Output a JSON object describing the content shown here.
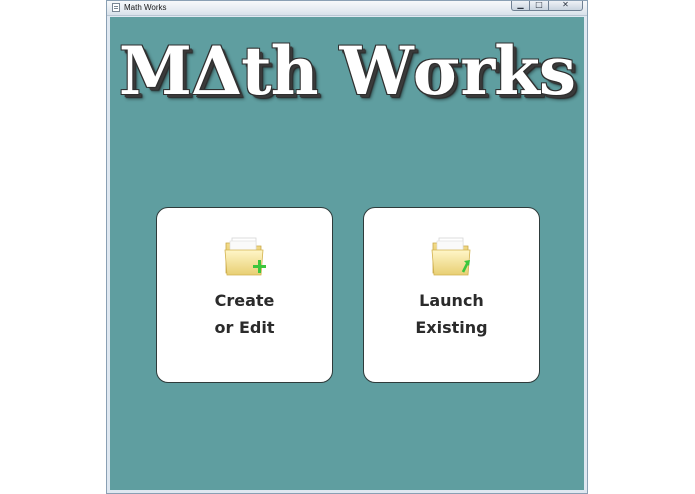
{
  "window": {
    "title": "Math Works",
    "controls": {
      "minimize_icon": "minimize-icon",
      "maximize_icon": "maximize-icon",
      "close_icon": "close-icon"
    }
  },
  "app": {
    "heading": "MΔth Wσrks",
    "background_color": "#5f9ea0"
  },
  "tiles": [
    {
      "id": "create",
      "line1": "Create",
      "line2": "or Edit",
      "icon": "folder-add-icon",
      "badge_color": "#3cc63c"
    },
    {
      "id": "launch",
      "line1": "Launch",
      "line2": "Existing",
      "icon": "folder-open-icon",
      "badge_color": "#3cc63c"
    }
  ]
}
